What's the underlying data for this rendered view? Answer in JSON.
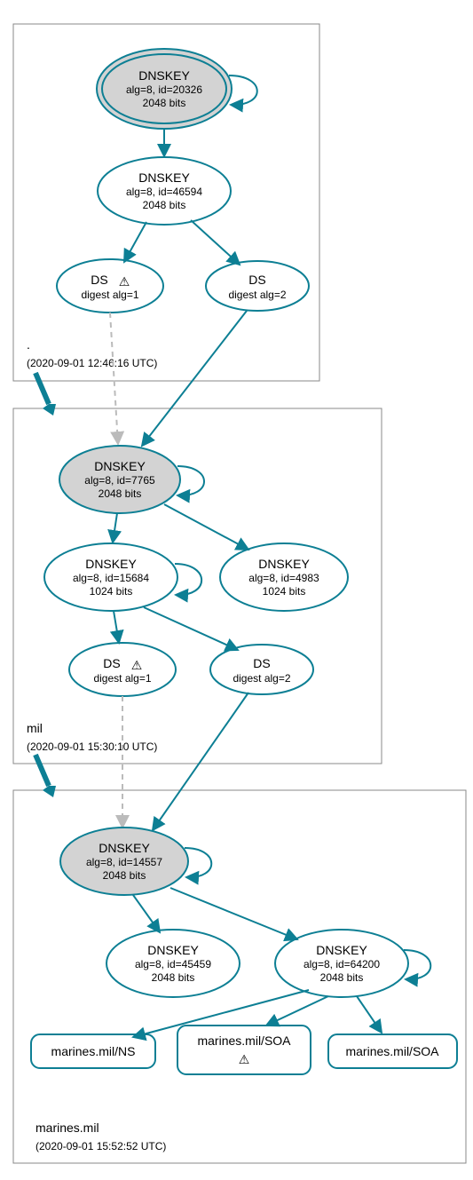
{
  "zones": [
    {
      "id": "root",
      "label": ".",
      "timestamp": "(2020-09-01 12:46:16 UTC)"
    },
    {
      "id": "mil",
      "label": "mil",
      "timestamp": "(2020-09-01 15:30:10 UTC)"
    },
    {
      "id": "marines",
      "label": "marines.mil",
      "timestamp": "(2020-09-01 15:52:52 UTC)"
    }
  ],
  "nodes": {
    "root_ksk": {
      "t1": "DNSKEY",
      "t2": "alg=8, id=20326",
      "t3": "2048 bits"
    },
    "root_zsk": {
      "t1": "DNSKEY",
      "t2": "alg=8, id=46594",
      "t3": "2048 bits"
    },
    "root_ds1": {
      "t1": "DS",
      "t2": "digest alg=1",
      "warn": true
    },
    "root_ds2": {
      "t1": "DS",
      "t2": "digest alg=2"
    },
    "mil_ksk": {
      "t1": "DNSKEY",
      "t2": "alg=8, id=7765",
      "t3": "2048 bits"
    },
    "mil_zsk1": {
      "t1": "DNSKEY",
      "t2": "alg=8, id=15684",
      "t3": "1024 bits"
    },
    "mil_zsk2": {
      "t1": "DNSKEY",
      "t2": "alg=8, id=4983",
      "t3": "1024 bits"
    },
    "mil_ds1": {
      "t1": "DS",
      "t2": "digest alg=1",
      "warn": true
    },
    "mil_ds2": {
      "t1": "DS",
      "t2": "digest alg=2"
    },
    "mar_ksk": {
      "t1": "DNSKEY",
      "t2": "alg=8, id=14557",
      "t3": "2048 bits"
    },
    "mar_zsk1": {
      "t1": "DNSKEY",
      "t2": "alg=8, id=45459",
      "t3": "2048 bits"
    },
    "mar_zsk2": {
      "t1": "DNSKEY",
      "t2": "alg=8, id=64200",
      "t3": "2048 bits"
    },
    "mar_ns": {
      "t1": "marines.mil/NS"
    },
    "mar_soa_w": {
      "t1": "marines.mil/SOA",
      "warn": true
    },
    "mar_soa": {
      "t1": "marines.mil/SOA"
    }
  },
  "warn_glyph": "⚠"
}
